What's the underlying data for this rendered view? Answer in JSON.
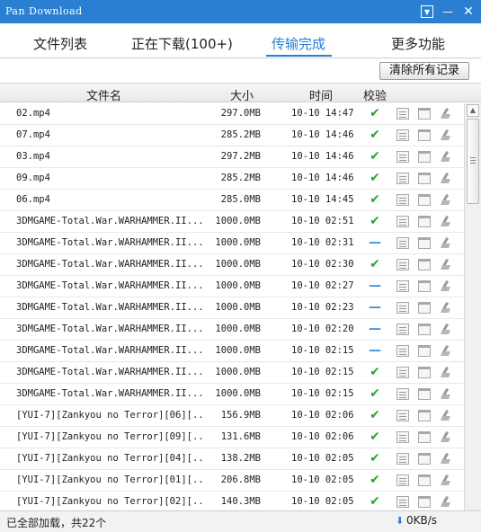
{
  "window": {
    "title": "Pan Download",
    "dropdown_glyph": "▼",
    "minimize_glyph": "—",
    "close_glyph": "✕"
  },
  "tabs": [
    {
      "label": "文件列表"
    },
    {
      "label": "正在下载(100+)"
    },
    {
      "label": "传输完成",
      "active": true
    },
    {
      "label": "更多功能"
    }
  ],
  "toolbar": {
    "clear_label": "清除所有记录"
  },
  "table": {
    "headers": {
      "name": "文件名",
      "size": "大小",
      "time": "时间",
      "verify": "校验"
    },
    "rows": [
      {
        "name": "02.mp4",
        "size": "297.0MB",
        "time": "10-10 14:47",
        "status": "ok"
      },
      {
        "name": "07.mp4",
        "size": "285.2MB",
        "time": "10-10 14:46",
        "status": "ok"
      },
      {
        "name": "03.mp4",
        "size": "297.2MB",
        "time": "10-10 14:46",
        "status": "ok"
      },
      {
        "name": "09.mp4",
        "size": "285.2MB",
        "time": "10-10 14:46",
        "status": "ok"
      },
      {
        "name": "06.mp4",
        "size": "285.0MB",
        "time": "10-10 14:45",
        "status": "ok"
      },
      {
        "name": "3DMGAME-Total.War.WARHAMMER.II....",
        "size": "1000.0MB",
        "time": "10-10 02:51",
        "status": "ok"
      },
      {
        "name": "3DMGAME-Total.War.WARHAMMER.II....",
        "size": "1000.0MB",
        "time": "10-10 02:31",
        "status": "pending"
      },
      {
        "name": "3DMGAME-Total.War.WARHAMMER.II....",
        "size": "1000.0MB",
        "time": "10-10 02:30",
        "status": "ok"
      },
      {
        "name": "3DMGAME-Total.War.WARHAMMER.II....",
        "size": "1000.0MB",
        "time": "10-10 02:27",
        "status": "pending"
      },
      {
        "name": "3DMGAME-Total.War.WARHAMMER.II....",
        "size": "1000.0MB",
        "time": "10-10 02:23",
        "status": "pending"
      },
      {
        "name": "3DMGAME-Total.War.WARHAMMER.II....",
        "size": "1000.0MB",
        "time": "10-10 02:20",
        "status": "pending"
      },
      {
        "name": "3DMGAME-Total.War.WARHAMMER.II....",
        "size": "1000.0MB",
        "time": "10-10 02:15",
        "status": "pending"
      },
      {
        "name": "3DMGAME-Total.War.WARHAMMER.II....",
        "size": "1000.0MB",
        "time": "10-10 02:15",
        "status": "ok"
      },
      {
        "name": "3DMGAME-Total.War.WARHAMMER.II....",
        "size": "1000.0MB",
        "time": "10-10 02:15",
        "status": "ok"
      },
      {
        "name": "[YUI-7][Zankyou no Terror][06][...",
        "size": "156.9MB",
        "time": "10-10 02:06",
        "status": "ok"
      },
      {
        "name": "[YUI-7][Zankyou no Terror][09][...",
        "size": "131.6MB",
        "time": "10-10 02:06",
        "status": "ok"
      },
      {
        "name": "[YUI-7][Zankyou no Terror][04][...",
        "size": "138.2MB",
        "time": "10-10 02:05",
        "status": "ok"
      },
      {
        "name": "[YUI-7][Zankyou no Terror][01][...",
        "size": "206.8MB",
        "time": "10-10 02:05",
        "status": "ok"
      },
      {
        "name": "[YUI-7][Zankyou no Terror][02][...",
        "size": "140.3MB",
        "time": "10-10 02:05",
        "status": "ok"
      }
    ],
    "status_glyphs": {
      "ok": "✔",
      "pending": "—"
    },
    "action_icons": [
      "file-icon",
      "folder-icon",
      "clear-icon"
    ]
  },
  "status": {
    "text": "已全部加载，共22个",
    "speed_arrow": "⬇",
    "speed": "0KB/s"
  },
  "colors": {
    "accent": "#2b7fd3",
    "ok": "#2aa52a",
    "pending": "#3b8fd8"
  }
}
